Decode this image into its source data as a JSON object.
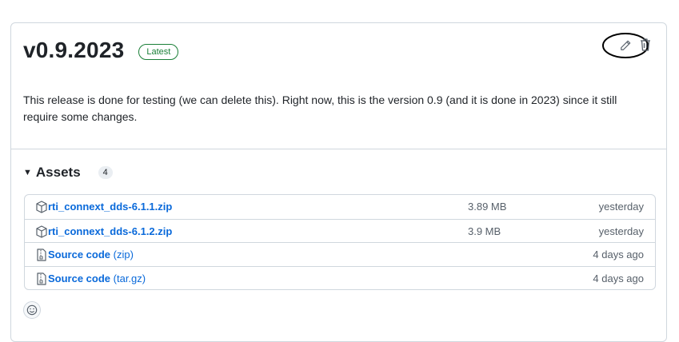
{
  "release": {
    "title": "v0.9.2023",
    "badge": "Latest",
    "description": "This release is done for testing (we can delete this). Right now, this is the version 0.9 (and it is done in 2023) since it still require some changes."
  },
  "assets": {
    "title": "Assets",
    "count": "4",
    "items": [
      {
        "name": "rti_connext_dds-6.1.1.zip",
        "suffix": "",
        "size": "3.89 MB",
        "date": "yesterday",
        "icon": "package-icon"
      },
      {
        "name": "rti_connext_dds-6.1.2.zip",
        "suffix": "",
        "size": "3.9 MB",
        "date": "yesterday",
        "icon": "package-icon"
      },
      {
        "name": "Source code",
        "suffix": " (zip)",
        "size": "",
        "date": "4 days ago",
        "icon": "file-zip-icon"
      },
      {
        "name": "Source code",
        "suffix": " (tar.gz)",
        "size": "",
        "date": "4 days ago",
        "icon": "file-zip-icon"
      }
    ]
  },
  "icons": {
    "edit": "pencil-icon",
    "delete": "trash-icon",
    "reaction": "smiley-icon"
  },
  "colors": {
    "link": "#0969da",
    "badge": "#1a7f37",
    "border": "#d0d7de"
  }
}
